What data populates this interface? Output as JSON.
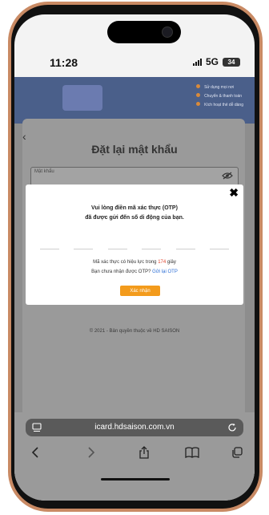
{
  "status": {
    "time": "11:28",
    "network": "5G",
    "battery": "34"
  },
  "page": {
    "title": "Đặt lại mật khẩu",
    "password_placeholder": "Mật khẩu",
    "footer": "© 2021 - Bản quyền thuộc về HD SAISON",
    "banner_items": [
      "Sử dụng mọi nơi",
      "Chuyển & thanh toán",
      "Kích hoạt thẻ dễ dàng"
    ]
  },
  "modal": {
    "close": "✖",
    "line1": "Vui lòng điền mã xác thực (OTP)",
    "line2": "đã được gửi đến số di động của bạn.",
    "validity_prefix": "Mã xác thực có hiệu lực trong ",
    "countdown": "174",
    "validity_suffix": " giây",
    "not_received": "Bạn chưa nhận được OTP? ",
    "resend": "Gửi lại OTP",
    "confirm": "Xác nhận"
  },
  "browser": {
    "url": "icard.hdsaison.com.vn"
  },
  "colors": {
    "accent_orange": "#f39b1c",
    "link_blue": "#2d6fd6",
    "countdown_red": "#e0442d",
    "frame": "#c98a64"
  }
}
